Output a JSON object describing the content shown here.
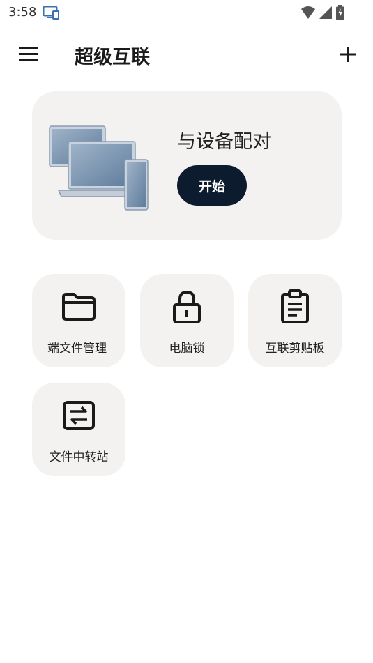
{
  "status_bar": {
    "time": "3:58",
    "icons": [
      "cast-icon",
      "wifi-icon",
      "signal-icon",
      "battery-charging-icon"
    ]
  },
  "app_bar": {
    "title": "超级互联",
    "menu_icon": "menu-icon",
    "add_icon": "plus-icon"
  },
  "pair_card": {
    "title": "与设备配对",
    "button_label": "开始",
    "illustration": "devices-illustration"
  },
  "tiles": [
    {
      "label": "端文件管理",
      "icon": "folder-icon"
    },
    {
      "label": "电脑锁",
      "icon": "lock-icon"
    },
    {
      "label": "互联剪贴板",
      "icon": "clipboard-icon"
    },
    {
      "label": "文件中转站",
      "icon": "transfer-icon"
    }
  ],
  "colors": {
    "card_bg": "#f3f2f0",
    "button_bg": "#0d1b2e",
    "button_text": "#ffffff",
    "text": "#1a1a1a"
  }
}
